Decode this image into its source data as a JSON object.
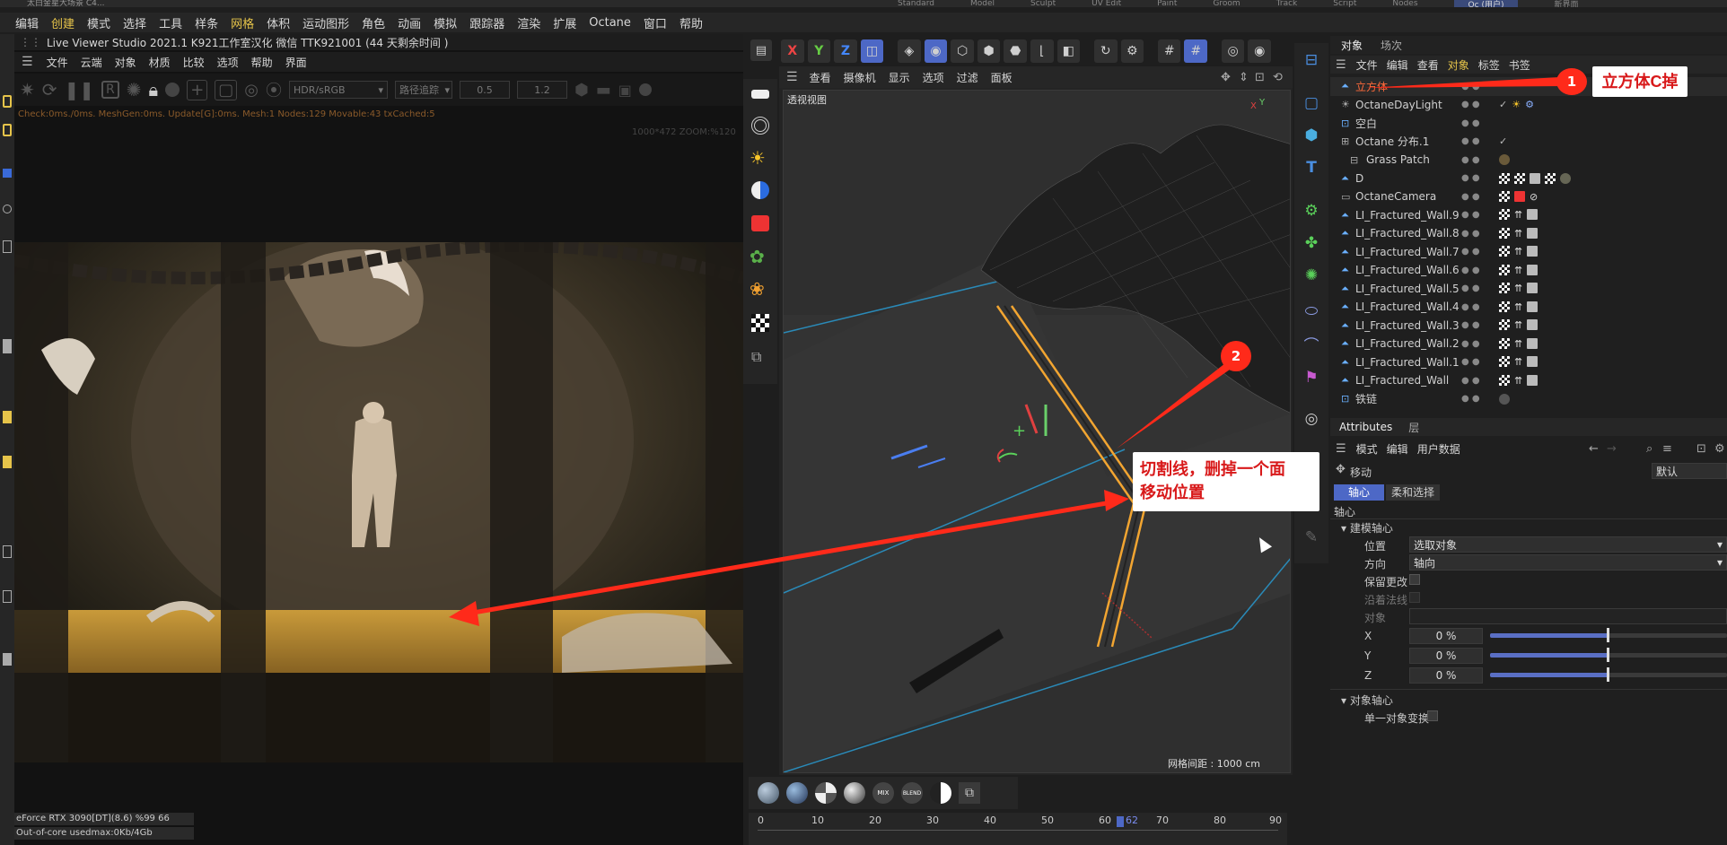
{
  "window": {
    "title": "太白金星大场景 C4..."
  },
  "top_tabs": [
    "Standard",
    "Model",
    "Sculpt",
    "UV Edit",
    "Paint",
    "Groom",
    "Track",
    "Script",
    "Nodes",
    "Oc (用户)",
    "新界面"
  ],
  "main_menu": [
    "编辑",
    "创建",
    "模式",
    "选择",
    "工具",
    "样条",
    "网格",
    "体积",
    "运动图形",
    "角色",
    "动画",
    "模拟",
    "跟踪器",
    "渲染",
    "扩展",
    "Octane",
    "窗口",
    "帮助"
  ],
  "live_viewer": {
    "title": "Live Viewer Studio 2021.1  K921工作室汉化  微信  TTK921001   (44 天剩余时间 )",
    "menu": [
      "文件",
      "云端",
      "对象",
      "材质",
      "比较",
      "选项",
      "帮助",
      "界面"
    ],
    "color_mode": "HDR/sRGB",
    "render_mode": "路径追踪",
    "value_a": "0.5",
    "value_b": "1.2",
    "stats": "Check:0ms./0ms. MeshGen:0ms. Update[G]:0ms. Mesh:1 Nodes:129 Movable:43 txCached:5",
    "zoom": "1000*472 ZOOM:%120",
    "gpu": "eForce RTX 3090[DT](8.6)  %99      66",
    "memory": "Out-of-core usedmax:0Kb/4Gb"
  },
  "viewport": {
    "menu": [
      "查看",
      "摄像机",
      "显示",
      "选项",
      "过滤",
      "面板"
    ],
    "label": "透视视图",
    "grid_info": "网格间距 : 1000 cm",
    "axis_tools": [
      "X",
      "Y",
      "Z"
    ]
  },
  "timeline": {
    "ticks": [
      "0",
      "10",
      "20",
      "30",
      "40",
      "50",
      "60",
      "70",
      "80",
      "90"
    ],
    "current_frame": "62",
    "material_labels": [
      "MIX",
      "BLEND"
    ]
  },
  "object_manager": {
    "tabs": [
      "对象",
      "场次"
    ],
    "menu": [
      "文件",
      "编辑",
      "查看",
      "对象",
      "标签",
      "书签"
    ],
    "items": [
      {
        "name": "立方体",
        "highlight": true
      },
      {
        "name": "OctaneDayLight"
      },
      {
        "name": "空白"
      },
      {
        "name": "Octane 分布.1"
      },
      {
        "name": "Grass Patch"
      },
      {
        "name": "D"
      },
      {
        "name": "OctaneCamera"
      },
      {
        "name": "LI_Fractured_Wall.9"
      },
      {
        "name": "LI_Fractured_Wall.8"
      },
      {
        "name": "LI_Fractured_Wall.7"
      },
      {
        "name": "LI_Fractured_Wall.6"
      },
      {
        "name": "LI_Fractured_Wall.5"
      },
      {
        "name": "LI_Fractured_Wall.4"
      },
      {
        "name": "LI_Fractured_Wall.3"
      },
      {
        "name": "LI_Fractured_Wall.2"
      },
      {
        "name": "LI_Fractured_Wall.1"
      },
      {
        "name": "LI_Fractured_Wall"
      },
      {
        "name": "铁链"
      }
    ]
  },
  "attributes": {
    "tabs": [
      "Attributes",
      "层"
    ],
    "menu": [
      "模式",
      "编辑",
      "用户数据"
    ],
    "tool": "移动",
    "preset": "默认",
    "subtabs": [
      "轴心",
      "柔和选择"
    ],
    "section": "轴心",
    "group1": "建模轴心",
    "position_label": "位置",
    "position_value": "选取对象",
    "direction_label": "方向",
    "direction_value": "轴向",
    "keep_change": "保留更改",
    "along_normal": "沿着法线",
    "object_label": "对象",
    "x_label": "X",
    "x_value": "0 %",
    "y_label": "Y",
    "y_value": "0 %",
    "z_label": "Z",
    "z_value": "0 %",
    "group2": "对象轴心",
    "single_transform": "单一对象变换"
  },
  "annotations": {
    "badge1": "1",
    "label1": "立方体C掉",
    "badge2": "2",
    "label2_line1": "切割线，删掉一个面",
    "label2_line2": "移动位置"
  },
  "colors": {
    "accent": "#e6c44a",
    "highlight_red": "#ff2a1a",
    "slider": "#5a6fc4",
    "selection": "#e6a531"
  }
}
